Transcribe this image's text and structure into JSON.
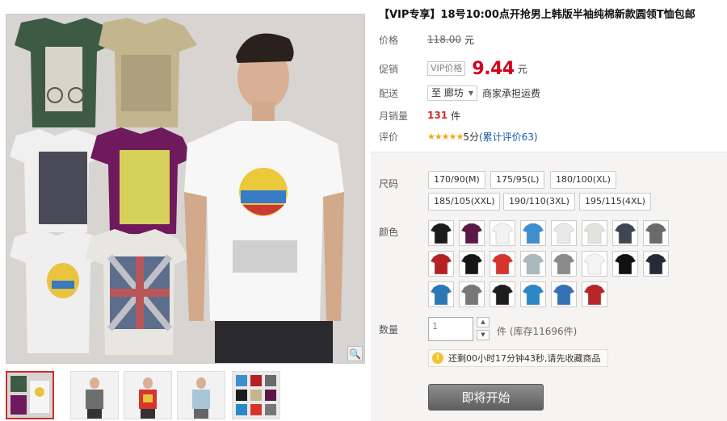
{
  "product": {
    "title": "【VIP专享】18号10:00点开抢男上韩版半袖纯棉新款圆领T恤包邮"
  },
  "price": {
    "label": "价格",
    "original": "118.00",
    "currency_unit": "元"
  },
  "promo": {
    "label": "促销",
    "tag": "VIP价格",
    "price": "9.44",
    "currency_unit": "元"
  },
  "shipping": {
    "label": "配送",
    "destination": "至 廊坊",
    "note": "商家承担运费"
  },
  "sales": {
    "label": "月销量",
    "count": "131",
    "unit": "件"
  },
  "rating": {
    "label": "评价",
    "stars": "★★★★★",
    "score": "5分",
    "review_link": "(累计评价63)"
  },
  "sizes": {
    "label": "尺码",
    "options": [
      "170/90(M)",
      "175/95(L)",
      "180/100(XL)",
      "185/105(XXL)",
      "190/110(3XL)",
      "195/115(4XL)"
    ]
  },
  "colors": {
    "label": "颜色",
    "swatches": [
      "#1b1b1b",
      "#5b1846",
      "#f2f2f2",
      "#3e8fd0",
      "#e9e9e9",
      "#e4e2dc",
      "#3e4650",
      "#6a6a6a",
      "#b42025",
      "#151515",
      "#d8332c",
      "#a9b7bf",
      "#8a8a8a",
      "#f4f4f4",
      "#111111",
      "#232a3a",
      "#2b78b8",
      "#777777",
      "#1d1d1d",
      "#2c87c6",
      "#3472b5",
      "#b8262a"
    ]
  },
  "quantity": {
    "label": "数量",
    "value": "1",
    "stock": "件 (库存11696件)"
  },
  "countdown": {
    "icon": "bulb-icon",
    "text": "还剩00小时17分钟43秒,请先收藏商品"
  },
  "buy_button": {
    "label": "即将开始"
  },
  "zoom_icon": "🔍"
}
